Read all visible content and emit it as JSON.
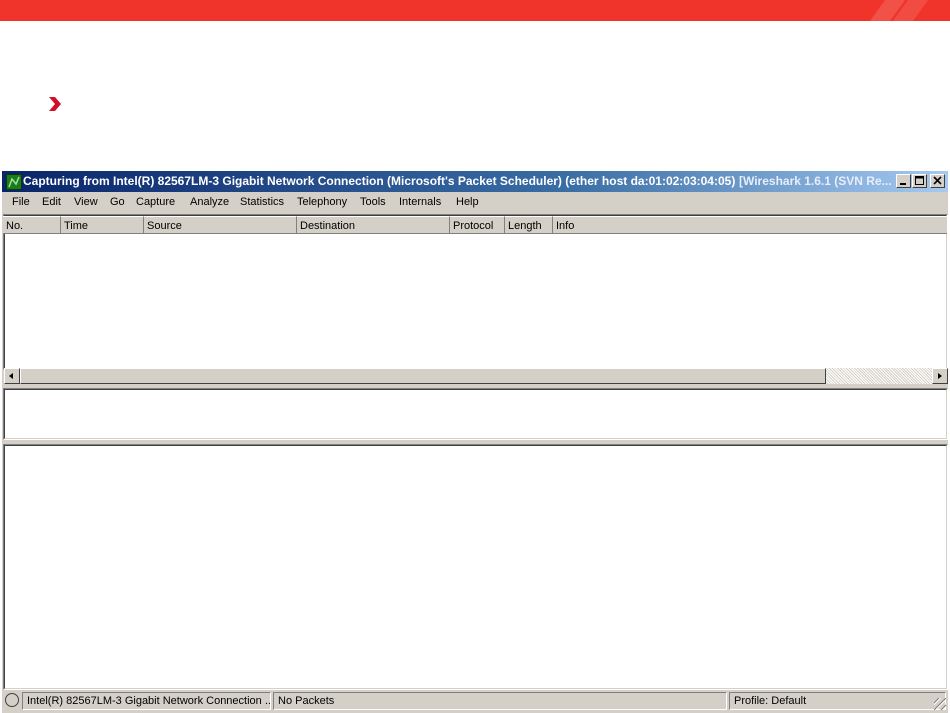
{
  "window": {
    "title": "Capturing from Intel(R) 82567LM-3 Gigabit Network Connection (Microsoft's Packet Scheduler)  (ether host da:01:02:03:04:05)",
    "title_suffix": "[Wireshark 1.6.1  (SVN Re...",
    "minimize": "_",
    "maximize": "□",
    "close": "✕"
  },
  "menu": [
    {
      "label": "File"
    },
    {
      "label": "Edit"
    },
    {
      "label": "View"
    },
    {
      "label": "Go"
    },
    {
      "label": "Capture"
    },
    {
      "label": "Analyze"
    },
    {
      "label": "Statistics"
    },
    {
      "label": "Telephony"
    },
    {
      "label": "Tools"
    },
    {
      "label": "Internals"
    },
    {
      "label": "Help"
    }
  ],
  "packet_list": {
    "columns": [
      "No.",
      "Time",
      "Source",
      "Destination",
      "Protocol",
      "Length",
      "Info"
    ],
    "rows": []
  },
  "status": {
    "interface": "Intel(R) 82567LM-3 Gigabit Network Connection ...",
    "packets": "No Packets",
    "profile": "Profile: Default"
  },
  "colors": {
    "brand_bar": "#f0342b",
    "bullet": "#d0102a",
    "titlebar_start": "#0a246a",
    "titlebar_end": "#a6caf0",
    "face": "#d4d0c8"
  },
  "icons": {
    "app": "wireshark-fin-icon",
    "bullet": "chevron-right-icon",
    "scroll_left": "arrow-left-icon",
    "scroll_right": "arrow-right-icon",
    "status_led": "capture-status-icon",
    "grip": "resize-grip-icon"
  }
}
